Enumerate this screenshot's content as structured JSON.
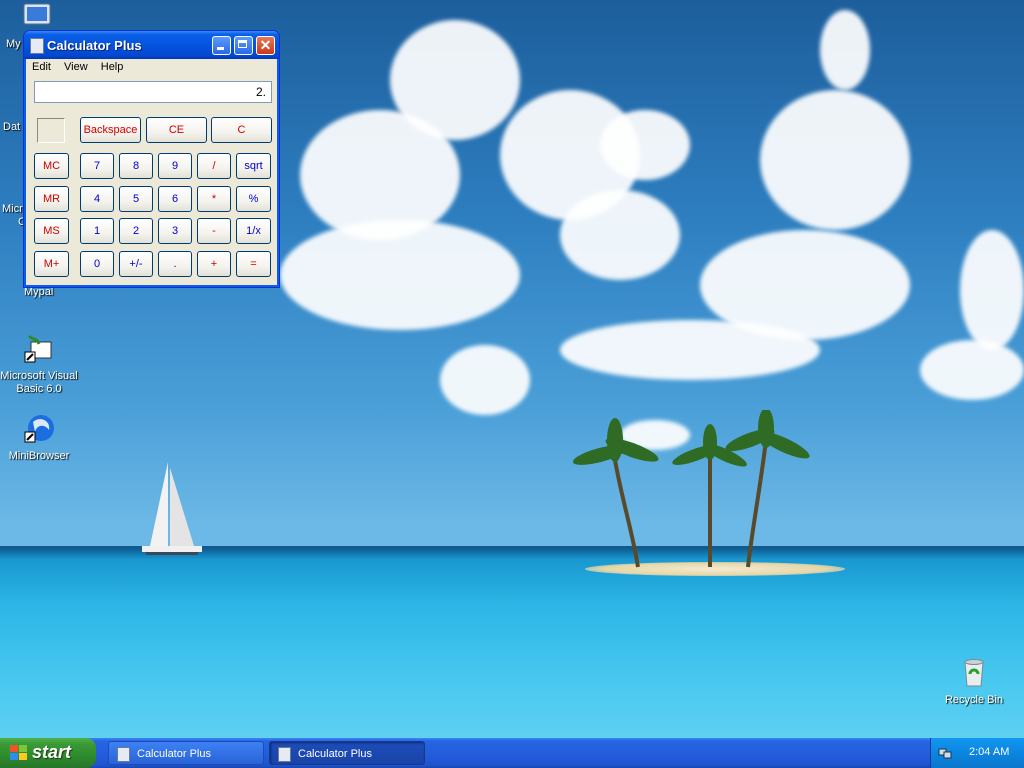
{
  "desktop": {
    "icons": [
      {
        "label": "Microsoft Visual Basic 6.0"
      },
      {
        "label": "MiniBrowser"
      },
      {
        "label": "Recycle Bin"
      }
    ],
    "partial_labels": [
      "My",
      "Dat",
      "Micro",
      "C",
      "Mypal"
    ]
  },
  "calculator": {
    "title": "Calculator Plus",
    "menu": [
      "Edit",
      "View",
      "Help"
    ],
    "display": "2.",
    "buttons": {
      "backspace": "Backspace",
      "ce": "CE",
      "c": "C",
      "mc": "MC",
      "mr": "MR",
      "ms": "MS",
      "mplus": "M+",
      "n7": "7",
      "n8": "8",
      "n9": "9",
      "div": "/",
      "sqrt": "sqrt",
      "n4": "4",
      "n5": "5",
      "n6": "6",
      "mul": "*",
      "pct": "%",
      "n1": "1",
      "n2": "2",
      "n3": "3",
      "sub": "-",
      "inv": "1/x",
      "n0": "0",
      "sign": "+/-",
      "dot": ".",
      "add": "+",
      "eq": "="
    }
  },
  "taskbar": {
    "start_label": "start",
    "tasks": [
      "Calculator Plus",
      "Calculator Plus"
    ],
    "clock": "2:04 AM"
  }
}
